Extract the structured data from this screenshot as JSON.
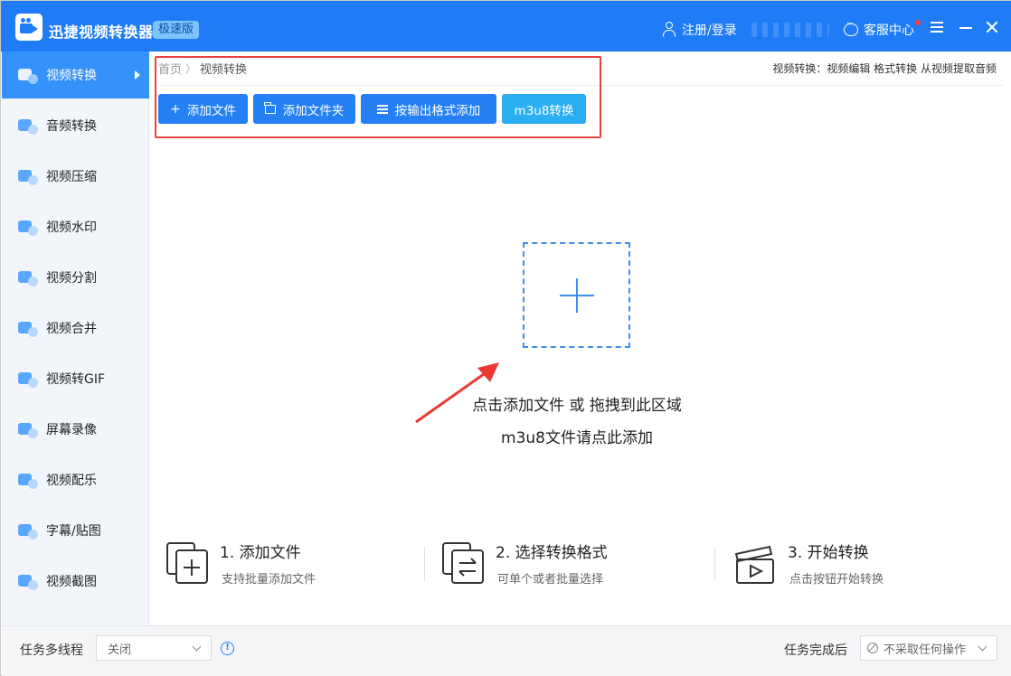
{
  "window": {
    "app_title": "迅捷视频转换器",
    "edition_badge": "极速版",
    "login_label": "注册/登录",
    "service_label": "客服中心",
    "colors": {
      "titlebar": "#1f7cf6",
      "accent": "#2580f4",
      "m3u8": "#2aaef2",
      "highlight_box": "#e8423b"
    }
  },
  "sidebar": {
    "items": [
      {
        "label": "视频转换",
        "icon": "video-convert-icon",
        "active": true
      },
      {
        "label": "音频转换",
        "icon": "audio-convert-icon"
      },
      {
        "label": "视频压缩",
        "icon": "video-compress-icon"
      },
      {
        "label": "视频水印",
        "icon": "video-watermark-icon"
      },
      {
        "label": "视频分割",
        "icon": "video-split-icon"
      },
      {
        "label": "视频合并",
        "icon": "video-merge-icon"
      },
      {
        "label": "视频转GIF",
        "icon": "video-gif-icon"
      },
      {
        "label": "屏幕录像",
        "icon": "screen-record-icon"
      },
      {
        "label": "视频配乐",
        "icon": "video-music-icon"
      },
      {
        "label": "字幕/贴图",
        "icon": "subtitle-sticker-icon"
      },
      {
        "label": "视频截图",
        "icon": "video-screenshot-icon"
      }
    ]
  },
  "breadcrumb": {
    "home": "首页",
    "separator": "〉",
    "current": "视频转换"
  },
  "top_links": "视频转换：视频编辑 格式转换 从视频提取音频",
  "toolbar": {
    "add_file": "添加文件",
    "add_folder": "添加文件夹",
    "add_by_format": "按输出格式添加",
    "m3u8": "m3u8转换"
  },
  "drop_zone": {
    "line1": "点击添加文件 或 拖拽到此区域",
    "line2": "m3u8文件请点此添加"
  },
  "steps": [
    {
      "title": "1. 添加文件",
      "desc": "支持批量添加文件"
    },
    {
      "title": "2. 选择转换格式",
      "desc": "可单个或者批量选择"
    },
    {
      "title": "3. 开始转换",
      "desc": "点击按钮开始转换"
    }
  ],
  "bottom": {
    "multithread_label": "任务多线程",
    "multithread_value": "关闭",
    "after_task_label": "任务完成后",
    "after_task_value": "不采取任何操作"
  }
}
